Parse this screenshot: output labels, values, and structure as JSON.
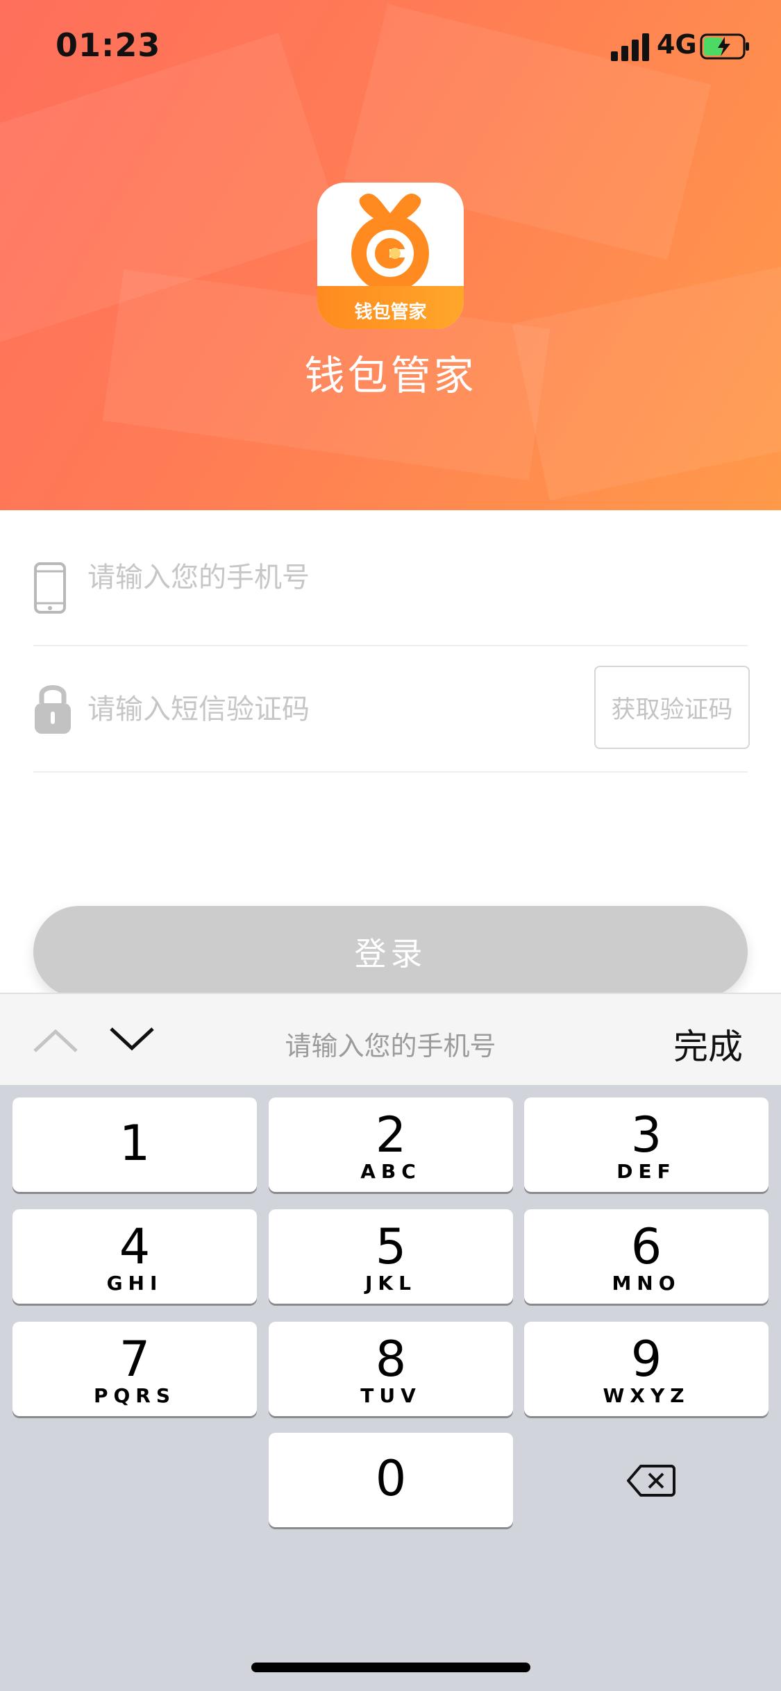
{
  "status_bar": {
    "time": "01:23",
    "network": "4G"
  },
  "app": {
    "name": "钱包管家",
    "icon_label": "钱包管家",
    "brand_color": "#ff8a1f"
  },
  "form": {
    "phone_placeholder": "请输入您的手机号",
    "code_placeholder": "请输入短信验证码",
    "get_code_label": "获取验证码",
    "login_label": "登录"
  },
  "keyboard_toolbar": {
    "hint": "请输入您的手机号",
    "done_label": "完成",
    "prev_icon": "chevron-up-icon",
    "next_icon": "chevron-down-icon"
  },
  "keypad": {
    "keys": [
      {
        "num": "1",
        "letters": ""
      },
      {
        "num": "2",
        "letters": "ABC"
      },
      {
        "num": "3",
        "letters": "DEF"
      },
      {
        "num": "4",
        "letters": "GHI"
      },
      {
        "num": "5",
        "letters": "JKL"
      },
      {
        "num": "6",
        "letters": "MNO"
      },
      {
        "num": "7",
        "letters": "PQRS"
      },
      {
        "num": "8",
        "letters": "TUV"
      },
      {
        "num": "9",
        "letters": "WXYZ"
      },
      {
        "num": "0",
        "letters": ""
      }
    ],
    "delete_icon": "backspace-icon"
  }
}
